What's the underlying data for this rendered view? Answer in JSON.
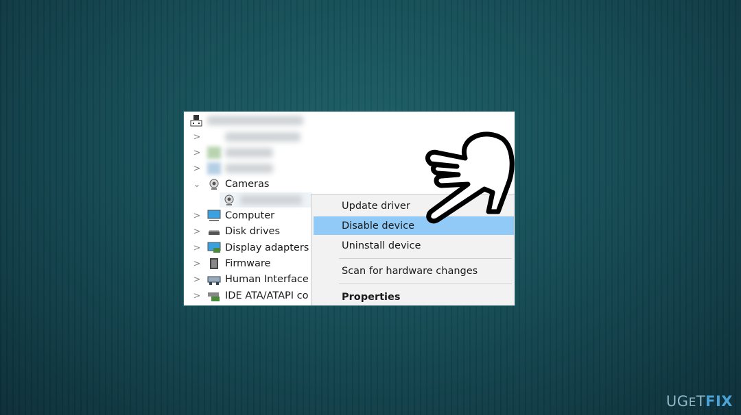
{
  "tree": {
    "items": [
      {
        "label": "Cameras",
        "expanded": true,
        "icon": "webcam-icon"
      },
      {
        "label": "Computer",
        "icon": "monitor-icon"
      },
      {
        "label": "Disk drives",
        "icon": "disk-drive-icon"
      },
      {
        "label": "Display adapters",
        "icon": "display-adapter-icon"
      },
      {
        "label": "Firmware",
        "icon": "chip-icon"
      },
      {
        "label": "Human Interface D",
        "icon": "hid-icon"
      },
      {
        "label": "IDE ATA/ATAPI co",
        "icon": "ide-controller-icon"
      }
    ]
  },
  "context_menu": {
    "items": [
      "Update driver",
      "Disable device",
      "Uninstall device",
      "Scan for hardware changes",
      "Properties"
    ],
    "highlighted": "Disable device"
  },
  "watermark": {
    "part1": "UG",
    "part2": "E",
    "part3": "T",
    "part4": "FIX"
  },
  "colors": {
    "highlight": "#91c9f7",
    "background": "#154c55",
    "logo_accent": "#4aa3d6"
  }
}
